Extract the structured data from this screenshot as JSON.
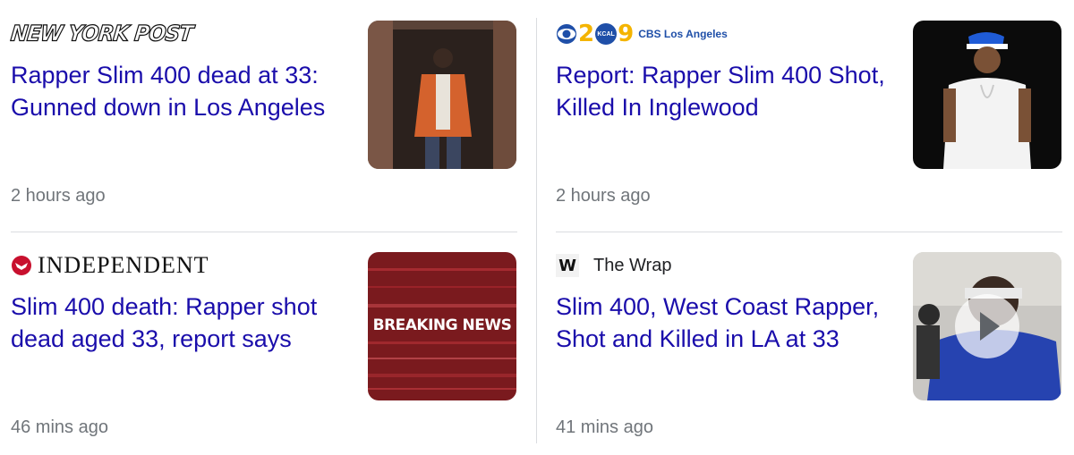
{
  "articles": [
    {
      "source": "NEW YORK POST",
      "headline": "Rapper Slim 400 dead at 33: Gunned down in Los Angeles",
      "time": "2 hours ago"
    },
    {
      "source": "CBS Los Angeles",
      "logo_numbers": [
        "2",
        "9"
      ],
      "logo_badge": "KCAL",
      "headline": "Report: Rapper Slim 400 Shot, Killed In Inglewood",
      "time": "2 hours ago"
    },
    {
      "source": "INDEPENDENT",
      "headline": "Slim 400 death: Rapper shot dead aged 33, report says",
      "thumb_text": "BREAKING NEWS",
      "time": "46 mins ago"
    },
    {
      "source": "The Wrap",
      "source_icon_letter": "W",
      "headline": "Slim 400, West Coast Rapper, Shot and Killed in LA at 33",
      "time": "41 mins ago",
      "has_video": true
    }
  ],
  "colors": {
    "headline": "#1a0dab",
    "time": "#70757a",
    "divider": "#dadce0"
  }
}
